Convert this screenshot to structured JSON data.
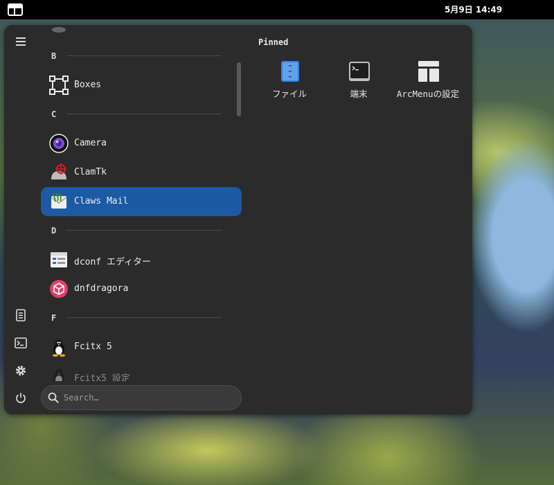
{
  "topbar": {
    "menu_icon": "arcmenu-layout-icon",
    "clock": "5月9日 14:49"
  },
  "sidebar": {
    "buttons": [
      {
        "icon": "hamburger-icon"
      },
      {
        "icon": "document-icon"
      },
      {
        "icon": "terminal-icon"
      },
      {
        "icon": "gear-icon"
      },
      {
        "icon": "power-icon"
      }
    ]
  },
  "app_list": {
    "sections": [
      {
        "letter": "B"
      },
      {
        "letter": "C"
      },
      {
        "letter": "D"
      },
      {
        "letter": "F"
      }
    ],
    "apps": [
      {
        "label": "Boxes",
        "icon": "boxes-icon"
      },
      {
        "label": "Camera",
        "icon": "camera-icon"
      },
      {
        "label": "ClamTk",
        "icon": "clamtk-icon"
      },
      {
        "label": "Claws Mail",
        "icon": "claws-mail-icon",
        "selected": true
      },
      {
        "label": "dconf エディター",
        "icon": "dconf-editor-icon"
      },
      {
        "label": "dnfdragora",
        "icon": "dnfdragora-icon"
      },
      {
        "label": "Fcitx 5",
        "icon": "tux-icon"
      },
      {
        "label": "Fcitx5 設定",
        "icon": "tux-icon"
      }
    ]
  },
  "search": {
    "placeholder": "Search…",
    "value": ""
  },
  "pinned": {
    "title": "Pinned",
    "items": [
      {
        "label": "ファイル",
        "icon": "files-icon"
      },
      {
        "label": "端末",
        "icon": "terminal-icon"
      },
      {
        "label": "ArcMenuの設定",
        "icon": "arcmenu-settings-icon"
      }
    ]
  },
  "colors": {
    "accent": "#1c5aa3",
    "panel_bg": "#2b2b2b"
  }
}
